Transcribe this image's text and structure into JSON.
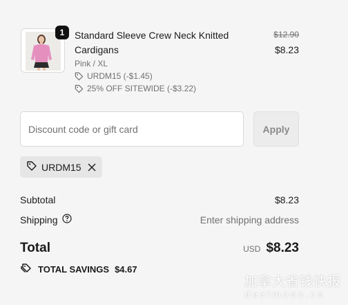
{
  "line_item": {
    "quantity": "1",
    "title": "Standard Sleeve Crew Neck Knitted Cardigans",
    "variant": "Pink / XL",
    "discounts": [
      "URDM15 (-$1.45)",
      "25% OFF SITEWIDE (-$3.22)"
    ],
    "original_price": "$12.90",
    "price": "$8.23",
    "discount_icon": "tag-icon",
    "sweater_color": "#e58fbf"
  },
  "discount_form": {
    "placeholder": "Discount code or gift card",
    "value": "",
    "apply_label": "Apply"
  },
  "applied_code": {
    "code": "URDM15",
    "tag_icon": "tag-icon",
    "remove_icon": "close-icon"
  },
  "summary": {
    "subtotal_label": "Subtotal",
    "subtotal_value": "$8.23",
    "shipping_label": "Shipping",
    "shipping_help_icon": "question-circle-icon",
    "shipping_value": "Enter shipping address",
    "total_label": "Total",
    "currency": "USD",
    "total_value": "$8.23",
    "savings_label": "TOTAL SAVINGS",
    "savings_value": "$4.67",
    "savings_icon": "tags-icon"
  },
  "watermark": {
    "chinese": "加拿大省钱快报",
    "latin": "dealmoon.ca"
  }
}
